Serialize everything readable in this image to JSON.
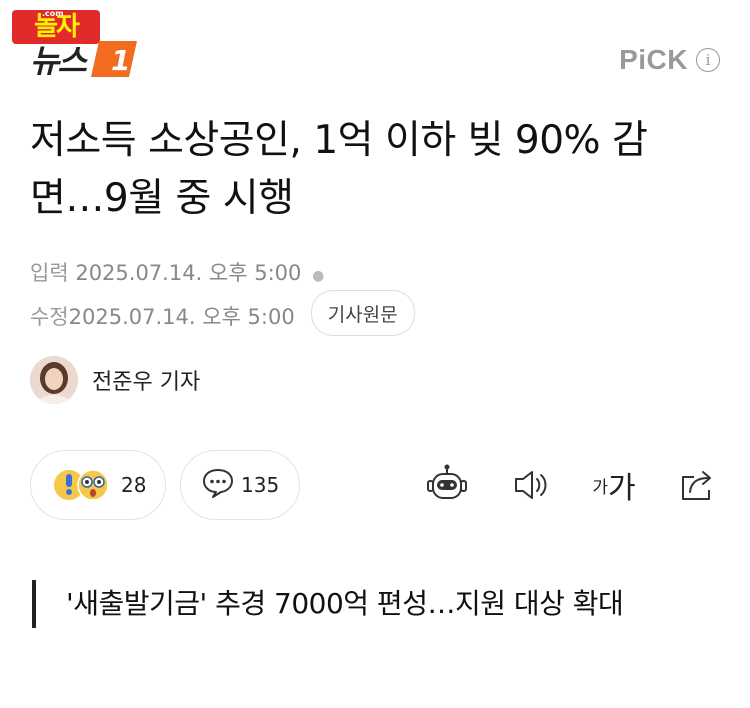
{
  "watermark": {
    "text": "놀자",
    "sub": ".com"
  },
  "logo": {
    "text": "뉴스",
    "badge": "1"
  },
  "pick": {
    "label": "PiCK",
    "info_glyph": "i"
  },
  "article": {
    "headline": "저소득 소상공인, 1억 이하 빚 90% 감면…9월 중 시행",
    "input_label": "입력",
    "input_datetime": "2025.07.14. 오후 5:00",
    "modified_label": "수정",
    "modified_datetime": "2025.07.14. 오후 5:00",
    "original_button": "기사원문"
  },
  "reporter": {
    "name": "전준우 기자"
  },
  "reactions": {
    "count": "28",
    "emojis": [
      "exclamation-face-icon",
      "surprised-face-icon"
    ]
  },
  "comments": {
    "count": "135",
    "icon": "comment-bubble-icon"
  },
  "toolbar": {
    "icons": [
      "robot-summary-icon",
      "speaker-icon",
      "font-size-icon",
      "share-icon"
    ],
    "font_size_small": "가",
    "font_size_large": "가"
  },
  "related": {
    "text": "'새출발기금' 추경 7000억 편성…지원 대상 확대"
  },
  "colors": {
    "accent": "#f26c1f",
    "watermark_bg": "#e32a2a",
    "watermark_fg": "#fff200"
  }
}
